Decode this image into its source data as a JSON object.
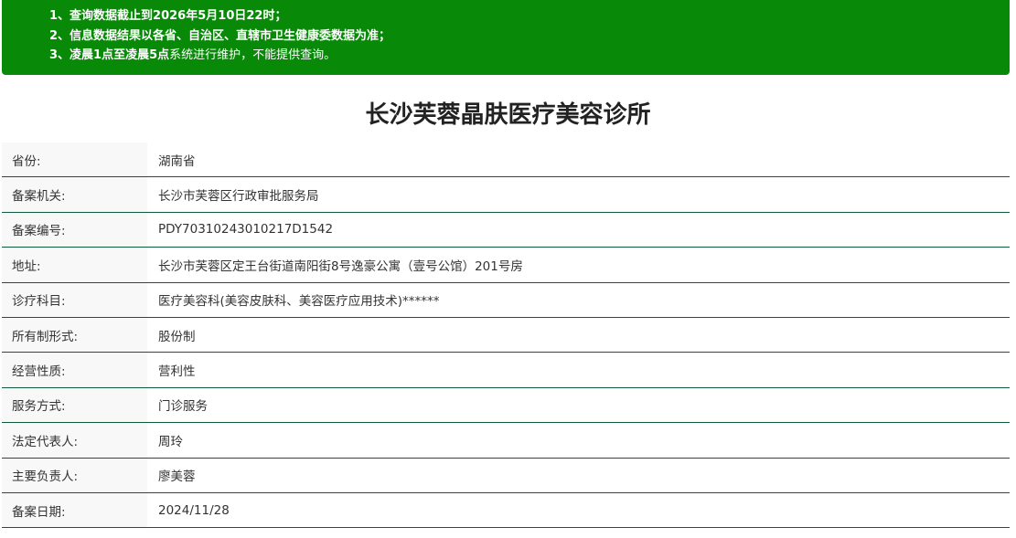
{
  "notice": {
    "line1": {
      "prefix": "1、",
      "bold": "查询数据截止到2026年5月10日22时；"
    },
    "line2": {
      "prefix": "2、",
      "bold": "信息数据结果以各省、自治区、直辖市卫生健康委数据为准；"
    },
    "line3": {
      "prefix": "3、",
      "bold": "凌晨1点至凌晨5点",
      "rest": "系统进行维护，不能提供查询。"
    }
  },
  "title": "长沙芙蓉晶肤医疗美容诊所",
  "rows": [
    {
      "label": "省份:",
      "value": "湖南省"
    },
    {
      "label": "备案机关:",
      "value": "长沙市芙蓉区行政审批服务局"
    },
    {
      "label": "备案编号:",
      "value": "PDY70310243010217D1542"
    },
    {
      "label": "地址:",
      "value": "长沙市芙蓉区定王台街道南阳街8号逸豪公寓（壹号公馆）201号房"
    },
    {
      "label": "诊疗科目:",
      "value": "医疗美容科(美容皮肤科、美容医疗应用技术)******"
    },
    {
      "label": "所有制形式:",
      "value": "股份制"
    },
    {
      "label": "经营性质:",
      "value": "营利性"
    },
    {
      "label": "服务方式:",
      "value": "门诊服务"
    },
    {
      "label": "法定代表人:",
      "value": "周玲"
    },
    {
      "label": "主要负责人:",
      "value": "廖美蓉"
    },
    {
      "label": "备案日期:",
      "value": "2024/11/28"
    }
  ],
  "colors": {
    "notice_bg": "#088a08",
    "row_border": "#0f5a3a",
    "label_bg": "#f8f8f8"
  }
}
